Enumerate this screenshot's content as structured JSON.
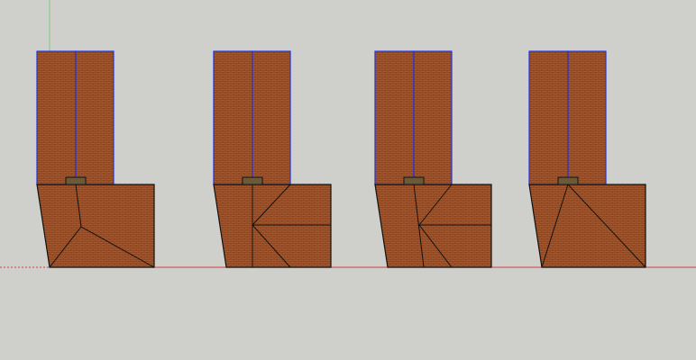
{
  "app": {
    "background_color": "#cfcfcb"
  },
  "axes": {
    "green_axis_color": "#7fcf7f",
    "red_axis_color": "#d04040"
  },
  "style": {
    "brick_base_color": "#a85a2c",
    "brick_mortar_color": "#7a3412",
    "blue_edge_color": "#2233dd",
    "black_edge_color": "#111111",
    "ledge_color": "#6b5a3a"
  },
  "models": [
    {
      "name": "model-1",
      "variant": "single-split-roof"
    },
    {
      "name": "model-2",
      "variant": "double-split-roof"
    },
    {
      "name": "model-3",
      "variant": "offset-split-roof"
    },
    {
      "name": "model-4",
      "variant": "diagonal-roof"
    }
  ]
}
